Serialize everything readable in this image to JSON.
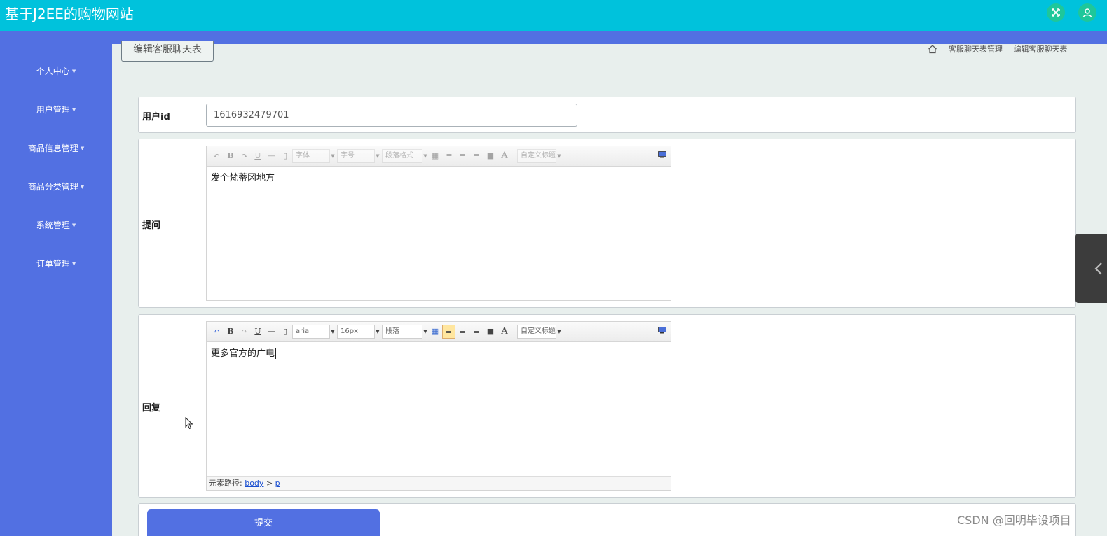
{
  "app": {
    "title": "基于J2EE的购物网站"
  },
  "header": {
    "expand_icon": "fullscreen-icon",
    "user_icon": "user-icon",
    "accent": "#00c2dc"
  },
  "sidebar": {
    "color": "#5270e2",
    "items": [
      {
        "label": "个人中心"
      },
      {
        "label": "用户管理"
      },
      {
        "label": "商品信息管理"
      },
      {
        "label": "商品分类管理"
      },
      {
        "label": "系统管理"
      },
      {
        "label": "订单管理"
      }
    ]
  },
  "page": {
    "tab_label": "编辑客服聊天表"
  },
  "breadcrumb": {
    "items": [
      "客服聊天表管理",
      "编辑客服聊天表"
    ]
  },
  "form": {
    "user_id": {
      "label": "用户id",
      "value": "1616932479701"
    },
    "question": {
      "label": "提问",
      "content": "发个梵蒂冈地方",
      "toolbar": {
        "font": "字体",
        "size": "字号",
        "para": "段落格式",
        "custom": "自定义标题"
      }
    },
    "reply": {
      "label": "回复",
      "content": "更多官方的广电",
      "toolbar": {
        "font": "arial",
        "size": "16px",
        "para": "段落",
        "custom": "自定义标题"
      },
      "path_label": "元素路径:",
      "path_body": "body",
      "path_sep": ">",
      "path_p": "p"
    },
    "submit_label": "提交"
  },
  "watermark": "CSDN @回明毕设项目"
}
